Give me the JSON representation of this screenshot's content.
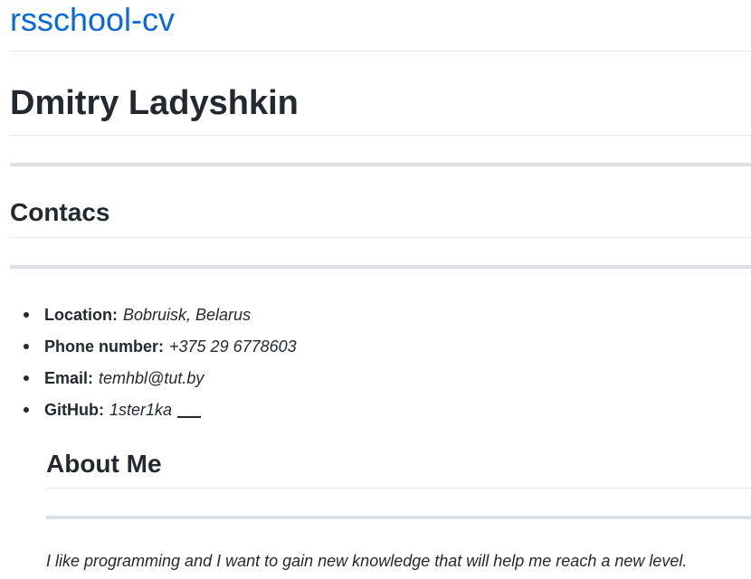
{
  "site": {
    "title": "rsschool-cv"
  },
  "header": {
    "name": "Dmitry Ladyshkin"
  },
  "contacts": {
    "heading": "Contacs",
    "items": [
      {
        "label": "Location:",
        "value": "Bobruisk, Belarus"
      },
      {
        "label": "Phone number:",
        "value": "+375 29 6778603"
      },
      {
        "label": "Email:",
        "value": "temhbl@tut.by"
      },
      {
        "label": "GitHub:",
        "value": "1ster1ka"
      }
    ]
  },
  "about": {
    "heading": "About Me",
    "text": "I like programming and I want to gain new knowledge that will help me reach a new level."
  },
  "colors": {
    "link": "#0969da",
    "text": "#24292f",
    "rule": "#dde1e6"
  }
}
